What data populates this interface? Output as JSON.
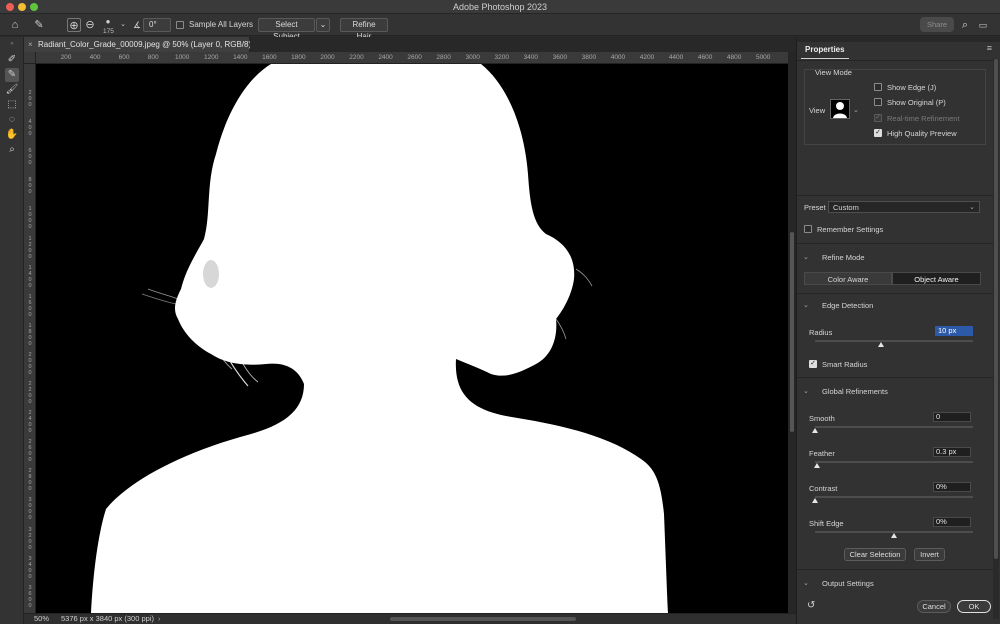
{
  "app": {
    "title": "Adobe Photoshop 2023"
  },
  "options_bar": {
    "brush_size": "175",
    "angle": "0°",
    "sample_all_layers": "Sample All Layers",
    "select_subject": "Select Subject",
    "refine_hair": "Refine Hair",
    "share": "Share"
  },
  "document": {
    "tab_title": "Radiant_Color_Grade_00009.jpeg @ 50% (Layer 0, RGB/8) *",
    "close": "×",
    "zoom": "50%",
    "info": "5376 px x 3840 px (300 ppi)"
  },
  "ruler": {
    "h_ticks": [
      "200",
      "400",
      "600",
      "800",
      "1000",
      "1200",
      "1400",
      "1600",
      "1800",
      "2000",
      "2200",
      "2400",
      "2600",
      "2800",
      "3000",
      "3200",
      "3400",
      "3600",
      "3800",
      "4000",
      "4200",
      "4400",
      "4600",
      "4800",
      "5000"
    ],
    "v_ticks": [
      "200",
      "400",
      "600",
      "800",
      "1000",
      "1200",
      "1400",
      "1600",
      "1800",
      "2000",
      "2200",
      "2400",
      "2600",
      "2800",
      "3000",
      "3200",
      "3400",
      "3600",
      "3800"
    ]
  },
  "properties": {
    "tab": "Properties",
    "view_mode": {
      "heading": "View Mode",
      "view_label": "View",
      "show_edge": "Show Edge (J)",
      "show_original": "Show Original (P)",
      "realtime": "Real-time Refinement",
      "hq_preview": "High Quality Preview"
    },
    "preset_label": "Preset",
    "preset_value": "Custom",
    "remember_settings": "Remember Settings",
    "refine_mode": {
      "heading": "Refine Mode",
      "color_aware": "Color Aware",
      "object_aware": "Object Aware"
    },
    "edge_detection": {
      "heading": "Edge Detection",
      "radius_label": "Radius",
      "radius_value": "10 px",
      "radius_level": 0.42,
      "smart_radius": "Smart Radius"
    },
    "global_refinements": {
      "heading": "Global Refinements",
      "smooth_label": "Smooth",
      "smooth_value": "0",
      "smooth_level": 0,
      "feather_label": "Feather",
      "feather_value": "0.3 px",
      "feather_level": 0.01,
      "contrast_label": "Contrast",
      "contrast_value": "0%",
      "contrast_level": 0,
      "shift_label": "Shift Edge",
      "shift_value": "0%",
      "shift_level": 0.5,
      "clear_selection": "Clear Selection",
      "invert": "Invert"
    },
    "output_settings": {
      "heading": "Output Settings"
    },
    "cancel": "Cancel",
    "ok": "OK"
  }
}
